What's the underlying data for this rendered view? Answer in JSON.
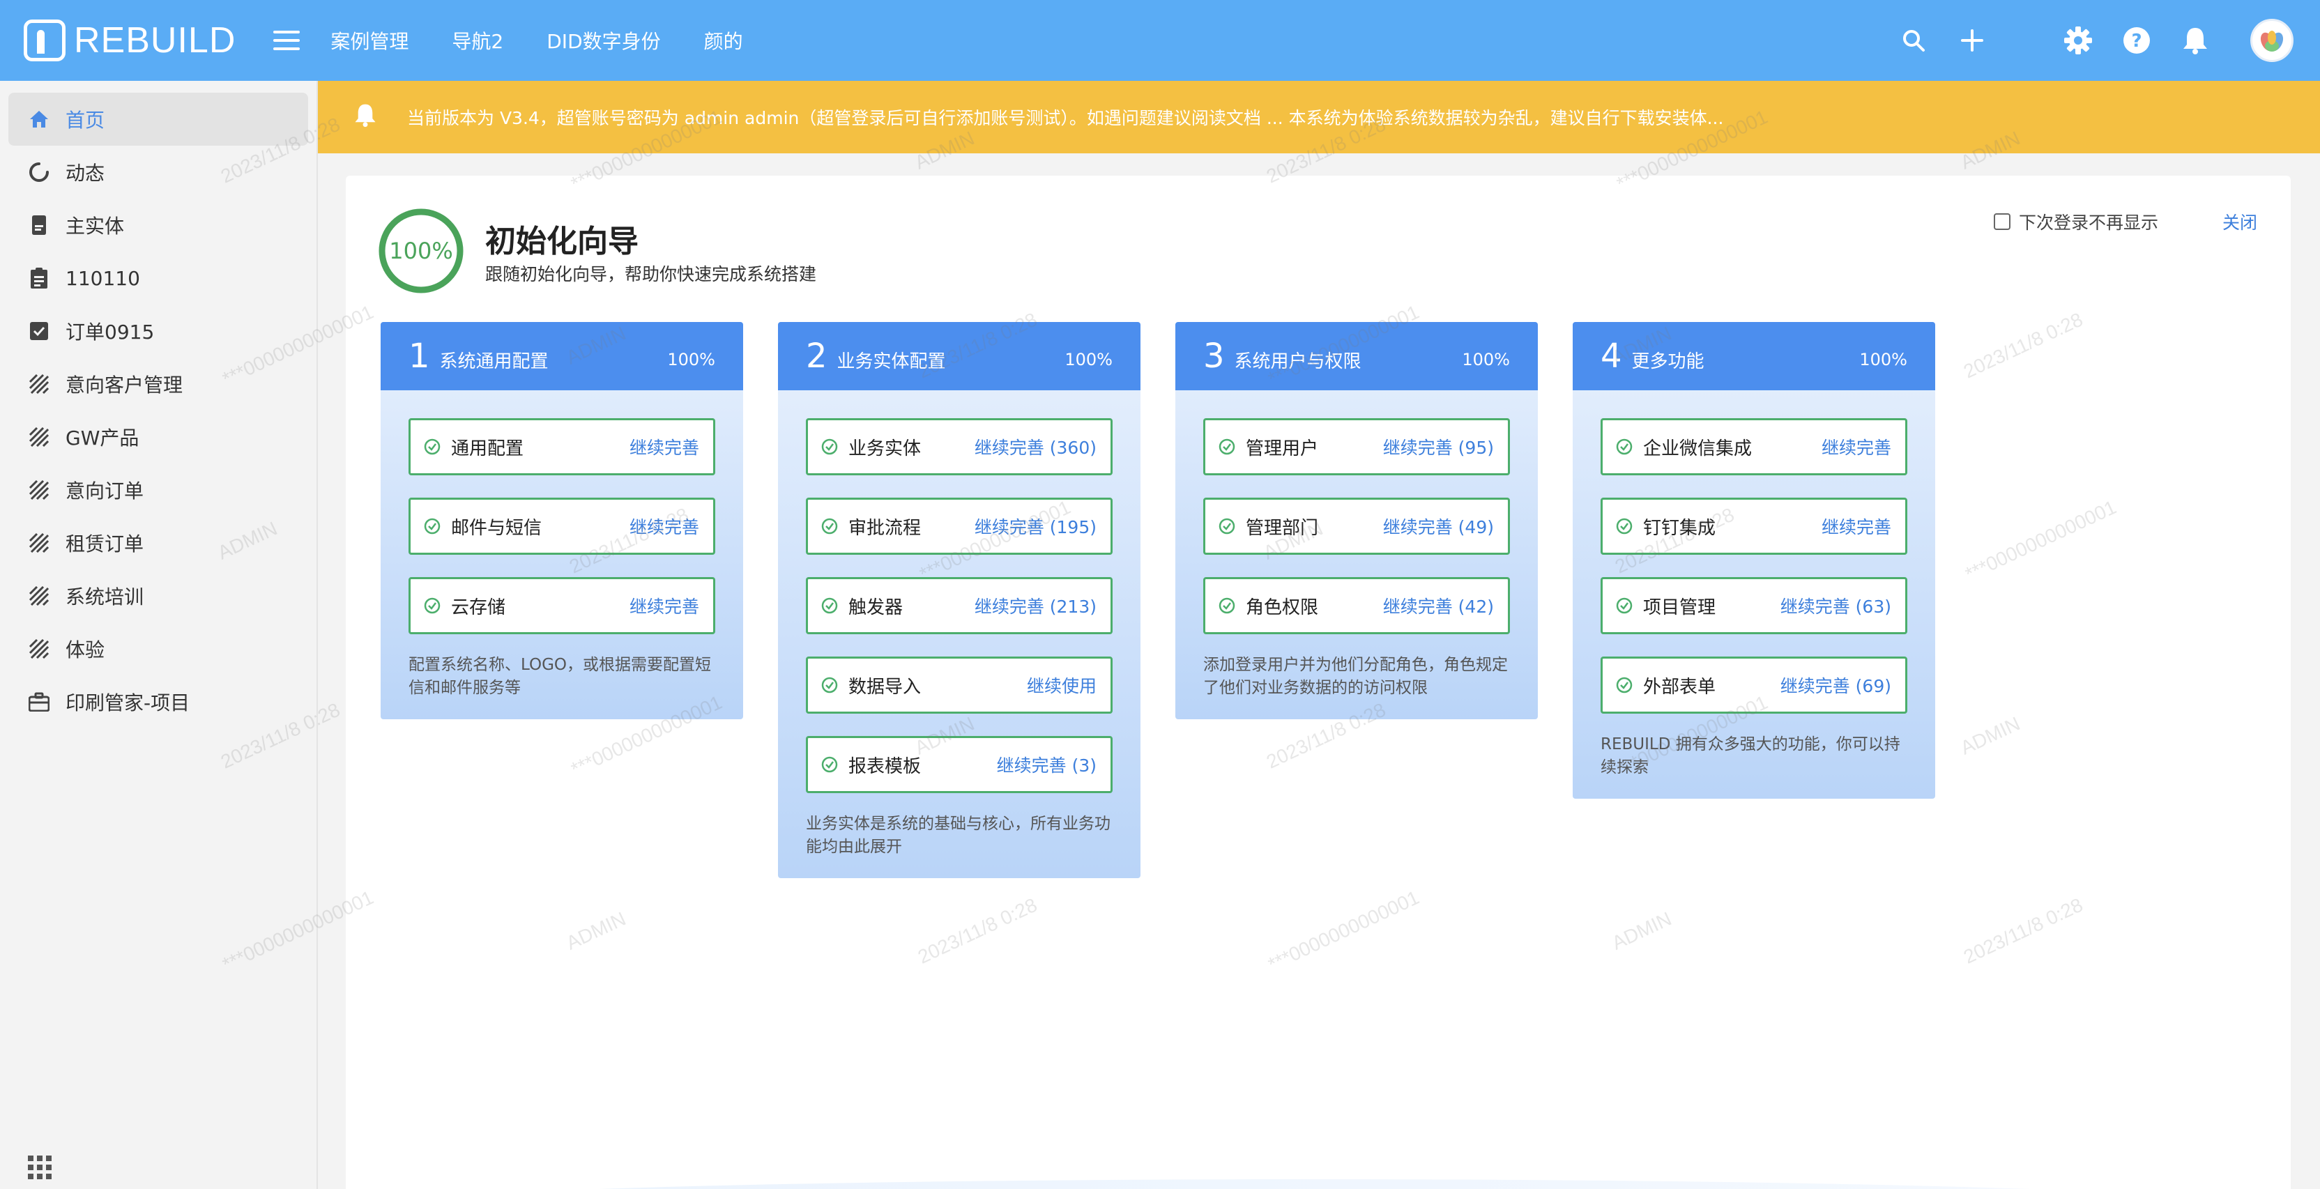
{
  "app": {
    "logo_text": "REBUILD"
  },
  "topnav": {
    "items": [
      "案例管理",
      "导航2",
      "DID数字身份",
      "颜的"
    ]
  },
  "top_actions": {
    "icons": [
      "search-icon",
      "plus-icon",
      "gear-icon",
      "help-icon",
      "bell-icon",
      "avatar"
    ]
  },
  "sidebar": {
    "items": [
      {
        "label": "首页",
        "icon": "home-icon",
        "active": true
      },
      {
        "label": "动态",
        "icon": "refresh-icon"
      },
      {
        "label": "主实体",
        "icon": "badge-icon"
      },
      {
        "label": "110110",
        "icon": "clipboard-icon"
      },
      {
        "label": "订单0915",
        "icon": "checkbox-icon"
      },
      {
        "label": "意向客户管理",
        "icon": "hatch-icon"
      },
      {
        "label": "GW产品",
        "icon": "hatch-icon"
      },
      {
        "label": "意向订单",
        "icon": "hatch-icon"
      },
      {
        "label": "租赁订单",
        "icon": "hatch-icon"
      },
      {
        "label": "系统培训",
        "icon": "hatch-icon"
      },
      {
        "label": "体验",
        "icon": "hatch-icon"
      },
      {
        "label": "印刷管家-项目",
        "icon": "briefcase-icon"
      }
    ]
  },
  "notice": {
    "text": "当前版本为 V3.4，超管账号密码为 admin admin（超管登录后可自行添加账号测试）。如遇问题建议阅读文档 ... 本系统为体验系统数据较为杂乱，建议自行下载安装体..."
  },
  "wizard": {
    "progress": "100%",
    "progress_value": 100,
    "title": "初始化向导",
    "subtitle": "跟随初始化向导，帮助你快速完成系统搭建",
    "dont_show": "下次登录不再显示",
    "close": "关闭"
  },
  "cards": [
    {
      "num": "1",
      "title": "系统通用配置",
      "pct": "100%",
      "items": [
        {
          "name": "通用配置",
          "link": "继续完善"
        },
        {
          "name": "邮件与短信",
          "link": "继续完善"
        },
        {
          "name": "云存储",
          "link": "继续完善"
        }
      ],
      "desc": "配置系统名称、LOGO，或根据需要配置短信和邮件服务等"
    },
    {
      "num": "2",
      "title": "业务实体配置",
      "pct": "100%",
      "items": [
        {
          "name": "业务实体",
          "link": "继续完善 (360)"
        },
        {
          "name": "审批流程",
          "link": "继续完善 (195)"
        },
        {
          "name": "触发器",
          "link": "继续完善 (213)"
        },
        {
          "name": "数据导入",
          "link": "继续使用"
        },
        {
          "name": "报表模板",
          "link": "继续完善 (3)"
        }
      ],
      "desc": "业务实体是系统的基础与核心，所有业务功能均由此展开"
    },
    {
      "num": "3",
      "title": "系统用户与权限",
      "pct": "100%",
      "items": [
        {
          "name": "管理用户",
          "link": "继续完善 (95)"
        },
        {
          "name": "管理部门",
          "link": "继续完善 (49)"
        },
        {
          "name": "角色权限",
          "link": "继续完善 (42)"
        }
      ],
      "desc": "添加登录用户并为他们分配角色，角色规定了他们对业务数据的的访问权限"
    },
    {
      "num": "4",
      "title": "更多功能",
      "pct": "100%",
      "items": [
        {
          "name": "企业微信集成",
          "link": "继续完善"
        },
        {
          "name": "钉钉集成",
          "link": "继续完善"
        },
        {
          "name": "项目管理",
          "link": "继续完善 (63)"
        },
        {
          "name": "外部表单",
          "link": "继续完善 (69)"
        }
      ],
      "desc": "REBUILD 拥有众多强大的功能，你可以持续探索"
    }
  ],
  "watermark": {
    "texts": [
      "2023/11/8 0:28",
      "***0000000000001",
      "ADMIN"
    ]
  },
  "colors": {
    "topbar": "#5aacf5",
    "notice": "#f4c042",
    "card_head": "#4c8eee",
    "success": "#4cae6c",
    "link": "#3d7fdc"
  }
}
